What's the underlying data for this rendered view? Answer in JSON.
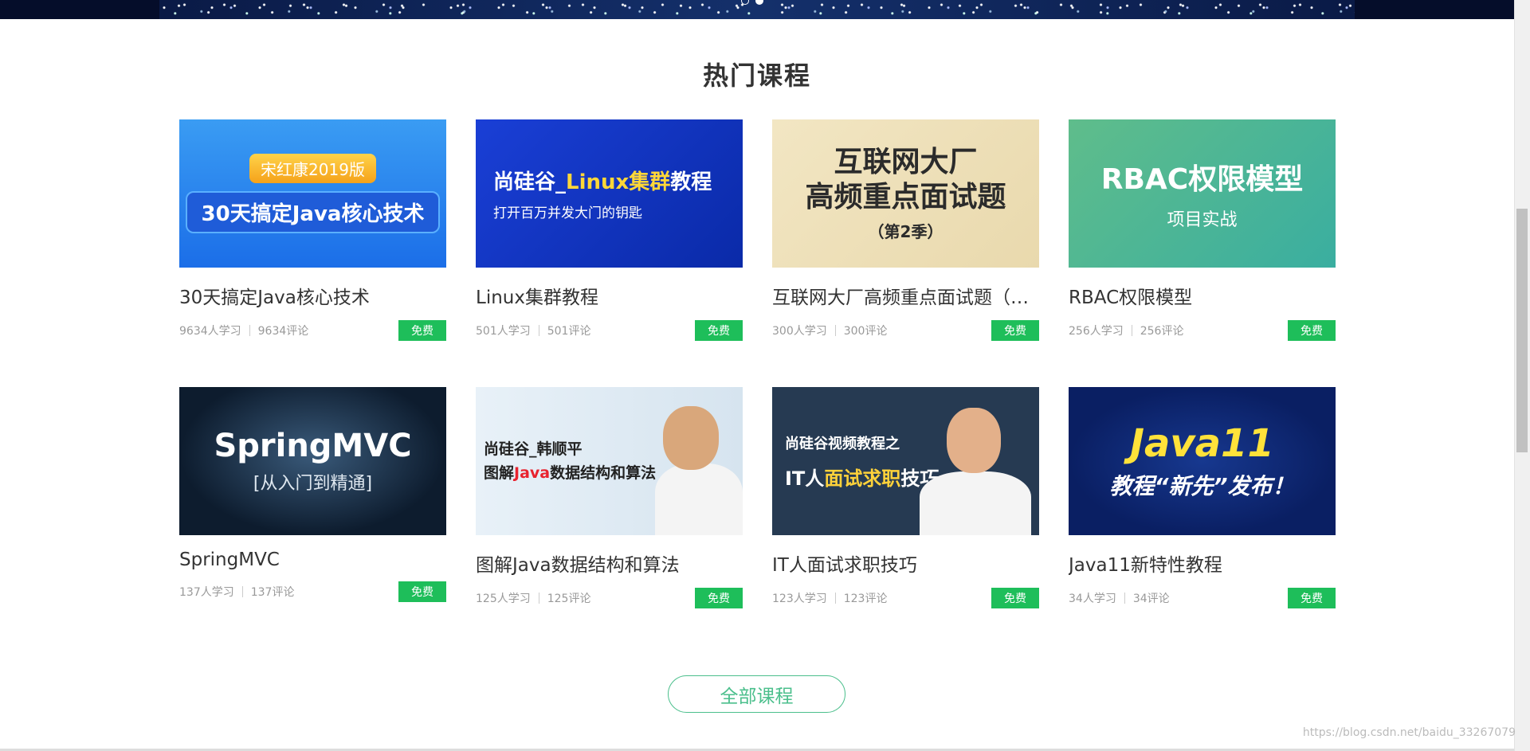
{
  "section_title": "热门课程",
  "courses": [
    {
      "name": "30天搞定Java核心技术",
      "students": "9634人学习",
      "comments": "9634评论",
      "price": "免费",
      "thumb": {
        "line1": "宋红康2019版",
        "line2": "30天搞定Java核心技术"
      }
    },
    {
      "name": "Linux集群教程",
      "students": "501人学习",
      "comments": "501评论",
      "price": "免费",
      "thumb": {
        "line1a": "尚硅谷_",
        "line1b": "Linux集群",
        "line1c": "教程",
        "line2": "打开百万并发大门的钥匙"
      }
    },
    {
      "name": "互联网大厂高频重点面试题（第...",
      "students": "300人学习",
      "comments": "300评论",
      "price": "免费",
      "thumb": {
        "line1": "互联网大厂",
        "line2": "高频重点面试题",
        "line3": "（第2季）"
      }
    },
    {
      "name": "RBAC权限模型",
      "students": "256人学习",
      "comments": "256评论",
      "price": "免费",
      "thumb": {
        "line1": "RBAC权限模型",
        "line2": "项目实战"
      }
    },
    {
      "name": "SpringMVC",
      "students": "137人学习",
      "comments": "137评论",
      "price": "免费",
      "thumb": {
        "line1": "SpringMVC",
        "line2": "[从入门到精通]"
      }
    },
    {
      "name": "图解Java数据结构和算法",
      "students": "125人学习",
      "comments": "125评论",
      "price": "免费",
      "thumb": {
        "line1": "尚硅谷_韩顺平",
        "line2a": "图解",
        "line2b": "Java",
        "line2c": "数据结构和算法"
      }
    },
    {
      "name": "IT人面试求职技巧",
      "students": "123人学习",
      "comments": "123评论",
      "price": "免费",
      "thumb": {
        "line1": "尚硅谷视频教程之",
        "line2a": "IT人",
        "line2b": "面试求职",
        "line2c": "技巧"
      }
    },
    {
      "name": "Java11新特性教程",
      "students": "34人学习",
      "comments": "34评论",
      "price": "免费",
      "thumb": {
        "line1": "Java11",
        "line2": "教程“新先”发布！"
      }
    }
  ],
  "all_courses_label": "全部课程",
  "watermark": "https://blog.csdn.net/baidu_33267079",
  "colors": {
    "accent_green": "#1ebe5a",
    "button_green": "#4bbf8c"
  }
}
